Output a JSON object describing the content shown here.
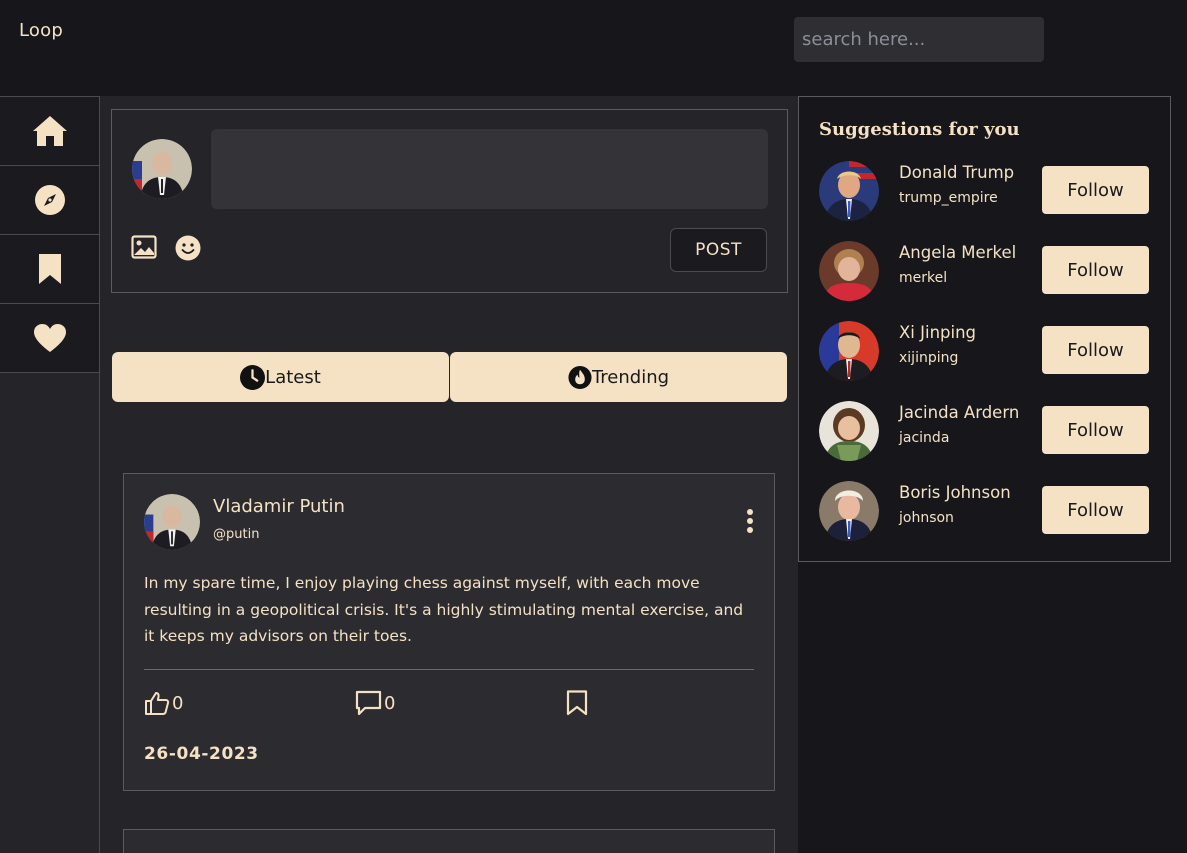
{
  "app": {
    "logo": "Loop"
  },
  "search": {
    "placeholder": "search here..."
  },
  "sidebar": {
    "items": [
      {
        "icon": "home-icon"
      },
      {
        "icon": "compass-icon"
      },
      {
        "icon": "bookmark-icon"
      },
      {
        "icon": "heart-icon"
      }
    ]
  },
  "composer": {
    "post_label": "POST"
  },
  "tabs": [
    {
      "label": "Latest",
      "icon": "clock-icon"
    },
    {
      "label": "Trending",
      "icon": "fire-icon"
    }
  ],
  "post": {
    "author": "Vladamir Putin",
    "handle": "@putin",
    "text": "In my spare time, I enjoy playing chess against myself, with each move resulting in a geopolitical crisis. It's a highly stimulating mental exercise, and it keeps my advisors on their toes.",
    "likes": "0",
    "comments": "0",
    "date": "26-04-2023"
  },
  "suggestions": {
    "title": "Suggestions for you",
    "follow_label": "Follow",
    "users": [
      {
        "name": "Donald Trump",
        "handle": "trump_empire"
      },
      {
        "name": "Angela Merkel",
        "handle": "merkel"
      },
      {
        "name": "Xi Jinping",
        "handle": "xijinping"
      },
      {
        "name": "Jacinda Ardern",
        "handle": "jacinda"
      },
      {
        "name": "Boris Johnson",
        "handle": "johnson"
      }
    ]
  },
  "colors": {
    "accent": "#f5e1c4",
    "background": "#16161b",
    "panel": "#242429"
  }
}
